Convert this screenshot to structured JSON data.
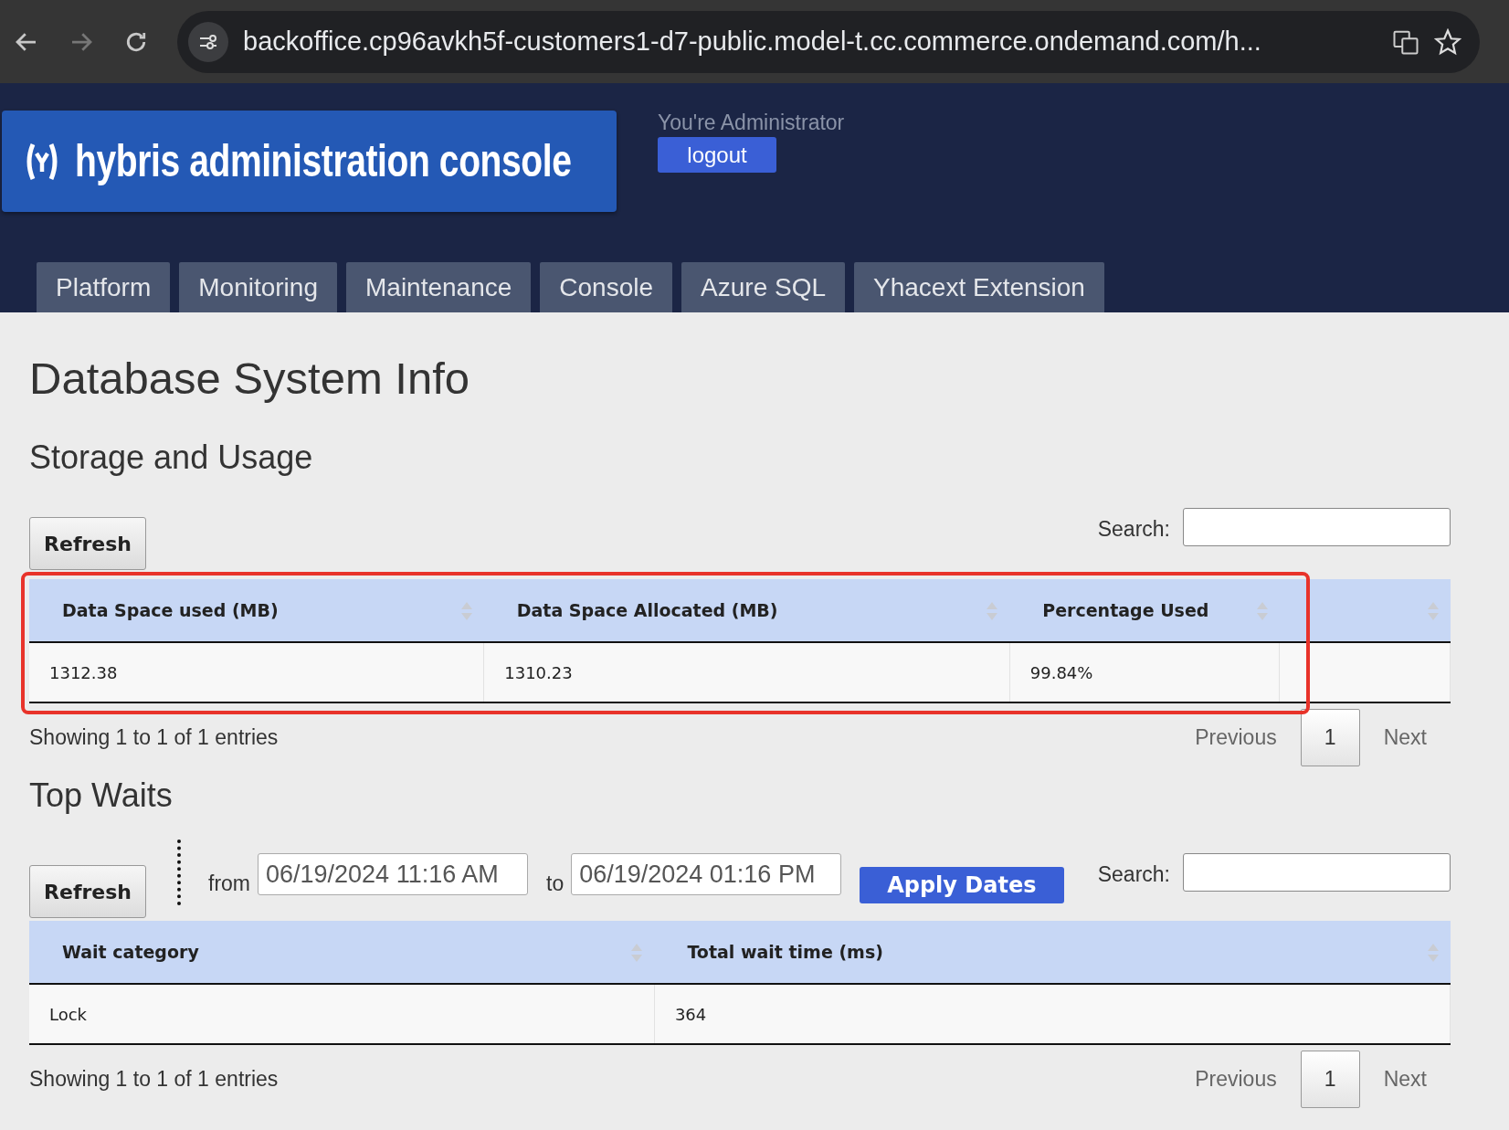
{
  "browser": {
    "url": "backoffice.cp96avkh5f-customers1-d7-public.model-t.cc.commerce.ondemand.com/h..."
  },
  "header": {
    "logo_text": "hybris administration console",
    "user_label": "You're Administrator",
    "logout": "logout"
  },
  "nav_tabs": [
    {
      "label": "Platform"
    },
    {
      "label": "Monitoring"
    },
    {
      "label": "Maintenance"
    },
    {
      "label": "Console"
    },
    {
      "label": "Azure SQL"
    },
    {
      "label": "Yhacext Extension"
    }
  ],
  "page_title": "Database System Info",
  "sections": [
    {
      "title": "Storage and Usage",
      "refresh": "Refresh",
      "search_label": "Search:",
      "highlighted": true,
      "columns": [
        "Data Space used (MB)",
        "Data Space Allocated (MB)",
        "Percentage Used",
        ""
      ],
      "rows": [
        [
          "1312.38",
          "1310.23",
          "99.84%",
          ""
        ]
      ],
      "info": "Showing 1 to 1 of 1 entries",
      "pagination": {
        "previous": "Previous",
        "page": "1",
        "next": "Next"
      }
    },
    {
      "title": "Top Waits",
      "refresh": "Refresh",
      "search_label": "Search:",
      "highlighted": false,
      "date_filter": {
        "from_label": "from",
        "from_value": "06/19/2024 11:16 AM",
        "to_label": "to",
        "to_value": "06/19/2024 01:16 PM",
        "apply": "Apply Dates"
      },
      "columns": [
        "Wait category",
        "Total wait time (ms)"
      ],
      "rows": [
        [
          "Lock",
          "364"
        ]
      ],
      "info": "Showing 1 to 1 of 1 entries",
      "pagination": {
        "previous": "Previous",
        "page": "1",
        "next": "Next"
      }
    }
  ]
}
